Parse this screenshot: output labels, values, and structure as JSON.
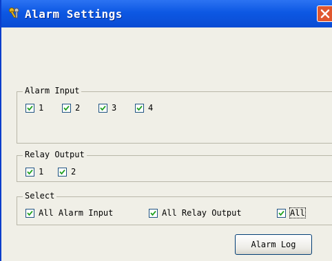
{
  "window": {
    "title": "Alarm Settings"
  },
  "alarm_input": {
    "legend": "Alarm Input",
    "items": [
      {
        "label": "1",
        "checked": true
      },
      {
        "label": "2",
        "checked": true
      },
      {
        "label": "3",
        "checked": true
      },
      {
        "label": "4",
        "checked": true
      }
    ]
  },
  "relay_output": {
    "legend": "Relay Output",
    "items": [
      {
        "label": "1",
        "checked": true
      },
      {
        "label": "2",
        "checked": true
      }
    ]
  },
  "select": {
    "legend": "Select",
    "all_alarm_input": "All Alarm Input",
    "all_relay_output": "All Relay Output",
    "all": "All"
  },
  "buttons": {
    "alarm_log": "Alarm Log"
  },
  "colors": {
    "titlebar": "#0a4bd3",
    "close": "#e0572f",
    "background": "#f0efe7"
  }
}
